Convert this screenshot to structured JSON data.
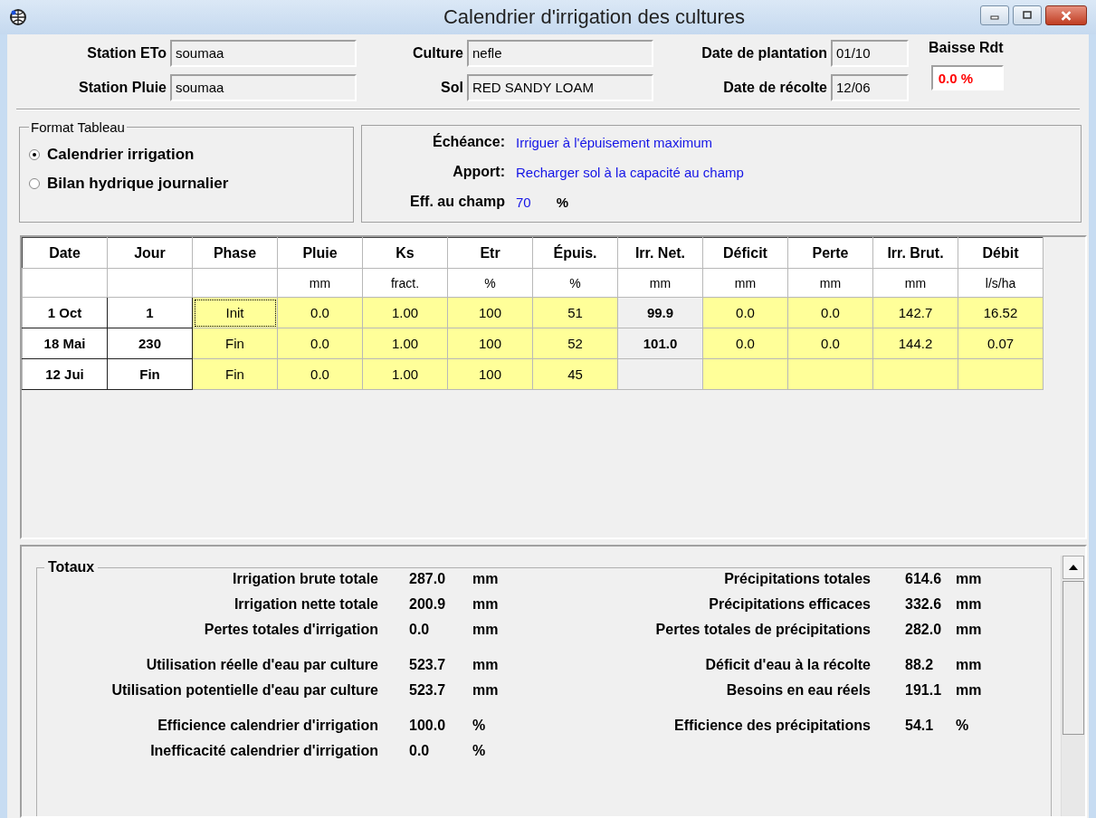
{
  "window": {
    "title": "Calendrier d'irrigation des cultures"
  },
  "header": {
    "fields": [
      {
        "label": "Station ETo",
        "value": "soumaa"
      },
      {
        "label": "Culture",
        "value": "nefle"
      },
      {
        "label": "Date de plantation",
        "value": "01/10"
      },
      {
        "label": "Station Pluie",
        "value": "soumaa"
      },
      {
        "label": "Sol",
        "value": "RED SANDY LOAM"
      },
      {
        "label": "Date de récolte",
        "value": "12/06"
      }
    ],
    "yield_drop": {
      "label": "Baisse Rdt",
      "value": "0.0 %"
    }
  },
  "format": {
    "title": "Format Tableau",
    "options": [
      {
        "label": "Calendrier irrigation",
        "selected": true
      },
      {
        "label": "Bilan hydrique journalier",
        "selected": false
      }
    ]
  },
  "settings": [
    {
      "label": "Échéance:",
      "value": "Irriguer à l'épuisement maximum"
    },
    {
      "label": "Apport:",
      "value": "Recharger sol à la capacité au champ"
    },
    {
      "label": "Eff. au champ",
      "value": "70",
      "unit": "%"
    }
  ],
  "table": {
    "columns": [
      {
        "label": "Date"
      },
      {
        "label": "Jour"
      },
      {
        "label": "Phase"
      },
      {
        "label": "Pluie",
        "unit": "mm"
      },
      {
        "label": "Ks",
        "unit": "fract."
      },
      {
        "label": "Etr",
        "unit": "%"
      },
      {
        "label": "Épuis.",
        "unit": "%"
      },
      {
        "label": "Irr. Net.",
        "unit": "mm"
      },
      {
        "label": "Déficit",
        "unit": "mm"
      },
      {
        "label": "Perte",
        "unit": "mm"
      },
      {
        "label": "Irr. Brut.",
        "unit": "mm"
      },
      {
        "label": "Débit",
        "unit": "l/s/ha"
      }
    ],
    "rows": [
      [
        {
          "kind": "label",
          "text": "1 Oct",
          "focused": false
        },
        {
          "kind": "label",
          "text": "1",
          "focused": false
        },
        {
          "kind": "value",
          "text": "Init",
          "focused": true
        },
        {
          "kind": "value",
          "text": "0.0",
          "focused": false
        },
        {
          "kind": "value",
          "text": "1.00",
          "focused": false
        },
        {
          "kind": "value",
          "text": "100",
          "focused": false
        },
        {
          "kind": "value",
          "text": "51",
          "focused": false
        },
        {
          "kind": "net",
          "text": "99.9",
          "focused": false
        },
        {
          "kind": "value",
          "text": "0.0",
          "focused": false
        },
        {
          "kind": "value",
          "text": "0.0",
          "focused": false
        },
        {
          "kind": "value",
          "text": "142.7",
          "focused": false
        },
        {
          "kind": "value",
          "text": "16.52",
          "focused": false
        }
      ],
      [
        {
          "kind": "label",
          "text": "18 Mai",
          "focused": false
        },
        {
          "kind": "label",
          "text": "230",
          "focused": false
        },
        {
          "kind": "value",
          "text": "Fin",
          "focused": false
        },
        {
          "kind": "value",
          "text": "0.0",
          "focused": false
        },
        {
          "kind": "value",
          "text": "1.00",
          "focused": false
        },
        {
          "kind": "value",
          "text": "100",
          "focused": false
        },
        {
          "kind": "value",
          "text": "52",
          "focused": false
        },
        {
          "kind": "net",
          "text": "101.0",
          "focused": false
        },
        {
          "kind": "value",
          "text": "0.0",
          "focused": false
        },
        {
          "kind": "value",
          "text": "0.0",
          "focused": false
        },
        {
          "kind": "value",
          "text": "144.2",
          "focused": false
        },
        {
          "kind": "value",
          "text": "0.07",
          "focused": false
        }
      ],
      [
        {
          "kind": "label",
          "text": "12 Jui",
          "focused": false
        },
        {
          "kind": "label",
          "text": "Fin",
          "focused": false
        },
        {
          "kind": "value",
          "text": "Fin",
          "focused": false
        },
        {
          "kind": "value",
          "text": "0.0",
          "focused": false
        },
        {
          "kind": "value",
          "text": "1.00",
          "focused": false
        },
        {
          "kind": "value",
          "text": "100",
          "focused": false
        },
        {
          "kind": "value",
          "text": "45",
          "focused": false
        },
        {
          "kind": "net",
          "focused": false
        },
        {
          "kind": "value",
          "focused": false
        },
        {
          "kind": "value",
          "focused": false
        },
        {
          "kind": "value",
          "focused": false
        },
        {
          "kind": "value",
          "focused": false
        }
      ]
    ]
  },
  "totals": {
    "title": "Totaux",
    "left": [
      [
        {
          "label": "Irrigation brute totale",
          "value": "287.0",
          "unit": "mm"
        },
        {
          "label": "Irrigation nette totale",
          "value": "200.9",
          "unit": "mm"
        },
        {
          "label": "Pertes totales d'irrigation",
          "value": "0.0",
          "unit": "mm"
        }
      ],
      [
        {
          "label": "Utilisation réelle d'eau par culture",
          "value": "523.7",
          "unit": "mm"
        },
        {
          "label": "Utilisation potentielle d'eau par culture",
          "value": "523.7",
          "unit": "mm"
        }
      ],
      [
        {
          "label": "Efficience calendrier d'irrigation",
          "value": "100.0",
          "unit": "%"
        },
        {
          "label": "Inefficacité calendrier d'irrigation",
          "value": "0.0",
          "unit": "%"
        }
      ]
    ],
    "right": [
      [
        {
          "label": "Précipitations totales",
          "value": "614.6",
          "unit": "mm"
        },
        {
          "label": "Précipitations efficaces",
          "value": "332.6",
          "unit": "mm"
        },
        {
          "label": "Pertes totales de précipitations",
          "value": "282.0",
          "unit": "mm"
        }
      ],
      [
        {
          "label": "Déficit d'eau à la récolte",
          "value": "88.2",
          "unit": "mm"
        },
        {
          "label": "Besoins en eau réels",
          "value": "191.1",
          "unit": "mm"
        }
      ],
      [
        {
          "label": "Efficience des précipitations",
          "value": "54.1",
          "unit": "%"
        }
      ]
    ]
  }
}
